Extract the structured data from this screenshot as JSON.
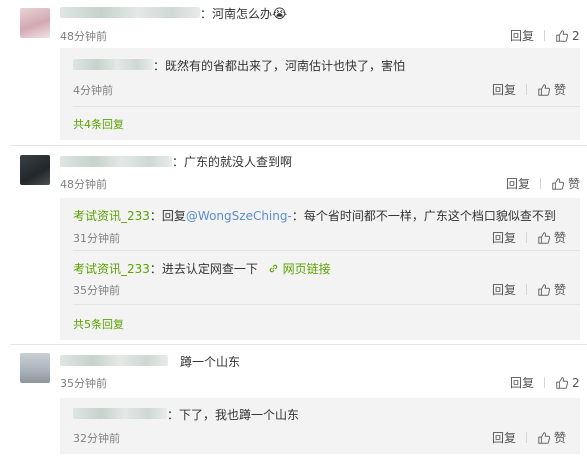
{
  "comments": [
    {
      "text": "：河南怎么办",
      "emoji": "😭",
      "time": "48分钟前",
      "reply_label": "回复",
      "like_count": "2",
      "replies": [
        {
          "text": "：既然有的省都出来了，河南估计也快了，害怕",
          "time": "4分钟前",
          "reply_label": "回复",
          "like_label": "赞"
        }
      ],
      "more_label": "共4条回复"
    },
    {
      "text": "：广东的就没人查到啊",
      "time": "48分钟前",
      "reply_label": "回复",
      "like_label": "赞",
      "replies": [
        {
          "user": "考试资讯_233",
          "text_prefix": "：回复",
          "mention": "@WongSzeChing-",
          "text": "：每个省时间都不一样，广东这个档口貌似查不到",
          "time": "31分钟前",
          "reply_label": "回复",
          "like_label": "赞"
        },
        {
          "user": "考试资讯_233",
          "text": "：进去认定网查一下",
          "link_icon": "link-icon",
          "link_text": "网页链接",
          "time": "35分钟前",
          "reply_label": "回复",
          "like_label": "赞"
        }
      ],
      "more_label": "共5条回复"
    },
    {
      "text": "蹲一个山东",
      "time": "35分钟前",
      "reply_label": "回复",
      "like_count": "2",
      "replies": [
        {
          "text": "：下了，我也蹲一个山东",
          "time": "32分钟前",
          "reply_label": "回复",
          "like_label": "赞"
        }
      ]
    }
  ],
  "colors": {
    "accent_green": "#5ba300",
    "link_blue": "#5a8fcf",
    "reply_bg": "#f3f3f3",
    "muted": "#808080"
  }
}
